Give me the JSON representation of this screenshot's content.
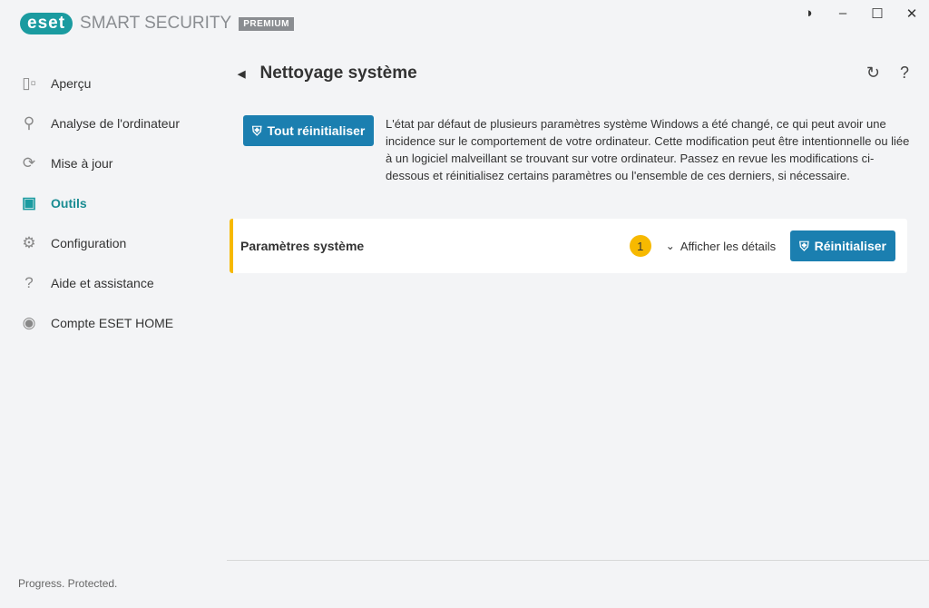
{
  "app": {
    "logo": "eset",
    "product": "SMART SECURITY",
    "edition": "PREMIUM",
    "tagline": "Progress. Protected."
  },
  "window": {
    "contrast": "◑",
    "minimize": "–",
    "maximize": "☐",
    "close": "✕"
  },
  "sidebar": {
    "items": [
      {
        "label": "Aperçu",
        "icon": "▯▫"
      },
      {
        "label": "Analyse de l'ordinateur",
        "icon": "⚲"
      },
      {
        "label": "Mise à jour",
        "icon": "⟳"
      },
      {
        "label": "Outils",
        "icon": "▣"
      },
      {
        "label": "Configuration",
        "icon": "⚙"
      },
      {
        "label": "Aide et assistance",
        "icon": "?"
      },
      {
        "label": "Compte ESET HOME",
        "icon": "◉"
      }
    ]
  },
  "page": {
    "back": "◀",
    "title": "Nettoyage système",
    "refresh": "↻",
    "help": "?",
    "reset_all": "Tout réinitialiser",
    "description": "L'état par défaut de plusieurs paramètres système Windows a été changé, ce qui peut avoir une incidence sur le comportement de votre ordinateur. Cette modification peut être intentionnelle ou liée à un logiciel malveillant se trouvant sur votre ordinateur. Passez en revue les modifications ci-dessous et réinitialisez certains paramètres ou l'ensemble de ces derniers, si nécessaire."
  },
  "card": {
    "label": "Paramètres système",
    "count": "1",
    "details": "Afficher les détails",
    "chevron": "⌄",
    "reset": "Réinitialiser"
  },
  "colors": {
    "accent": "#1a9ba0",
    "button": "#1b7fb0",
    "warning": "#f7b900"
  }
}
